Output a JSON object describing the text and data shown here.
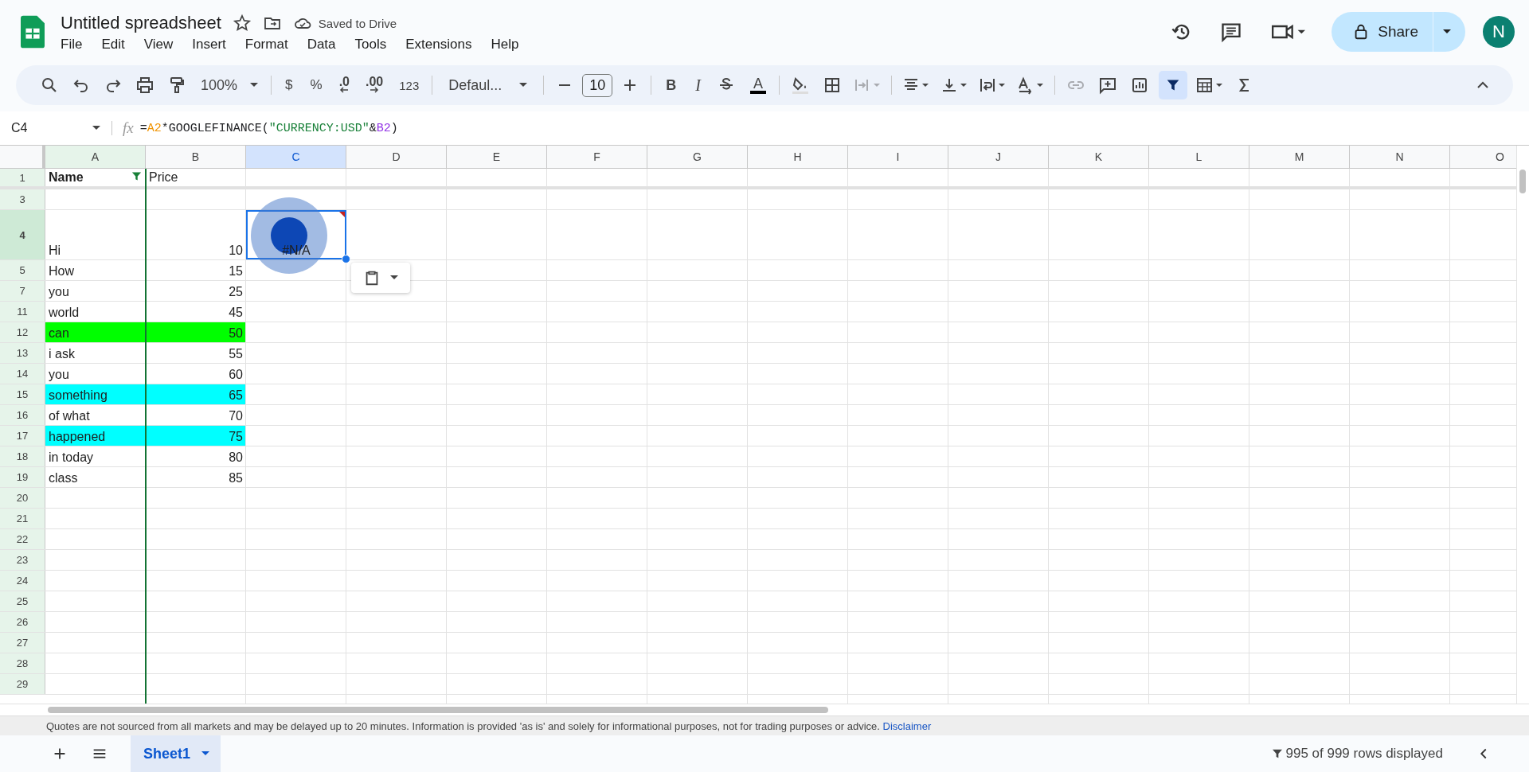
{
  "title": "Untitled spreadsheet",
  "save_status": "Saved to Drive",
  "menu": [
    "File",
    "Edit",
    "View",
    "Insert",
    "Format",
    "Data",
    "Tools",
    "Extensions",
    "Help"
  ],
  "share": {
    "label": "Share"
  },
  "avatar": "N",
  "toolbar": {
    "zoom": "100%",
    "currency": "$",
    "percent": "%",
    "decimal_decrease": ".0",
    "decimal_increase": ".00",
    "number_format": "123",
    "font": "Defaul...",
    "font_size": "10",
    "bold": "B",
    "italic": "I",
    "text_color": "A",
    "merge_disabled": true,
    "link_disabled": true,
    "filter_selected": true
  },
  "formula_bar": {
    "name_box": "C4",
    "function_label": "fx",
    "formula": [
      {
        "kind": "plain",
        "text": "="
      },
      {
        "kind": "ref_a",
        "text": "A2"
      },
      {
        "kind": "plain",
        "text": "*GOOGLEFINANCE("
      },
      {
        "kind": "string",
        "text": "\"CURRENCY:USD\""
      },
      {
        "kind": "plain",
        "text": "&"
      },
      {
        "kind": "ref_b",
        "text": "B2"
      },
      {
        "kind": "plain",
        "text": ")"
      }
    ]
  },
  "columns": [
    {
      "label": "A",
      "selected": false,
      "filtered": true
    },
    {
      "label": "B",
      "selected": false,
      "filtered": false
    },
    {
      "label": "C",
      "selected": true,
      "filtered": false
    },
    {
      "label": "D",
      "selected": false,
      "filtered": false
    },
    {
      "label": "E",
      "selected": false,
      "filtered": false
    },
    {
      "label": "F",
      "selected": false,
      "filtered": false
    },
    {
      "label": "G",
      "selected": false,
      "filtered": false
    },
    {
      "label": "H",
      "selected": false,
      "filtered": false
    },
    {
      "label": "I",
      "selected": false,
      "filtered": false
    },
    {
      "label": "J",
      "selected": false,
      "filtered": false
    },
    {
      "label": "K",
      "selected": false,
      "filtered": false
    },
    {
      "label": "L",
      "selected": false,
      "filtered": false
    },
    {
      "label": "M",
      "selected": false,
      "filtered": false
    },
    {
      "label": "N",
      "selected": false,
      "filtered": false
    },
    {
      "label": "O",
      "selected": false,
      "filtered": false
    }
  ],
  "rows": [
    {
      "number": "1",
      "selected": false,
      "cells": [
        "Name",
        "Price"
      ]
    },
    {
      "number": "3",
      "selected": false,
      "cells": []
    },
    {
      "number": "4",
      "selected": true,
      "cells": [
        "Hi",
        "10",
        "#N/A"
      ]
    },
    {
      "number": "5",
      "selected": false,
      "cells": [
        "How",
        "15"
      ]
    },
    {
      "number": "7",
      "selected": false,
      "cells": [
        "you",
        "25"
      ]
    },
    {
      "number": "11",
      "selected": false,
      "cells": [
        "world",
        "45"
      ]
    },
    {
      "number": "12",
      "selected": false,
      "color": "#00ff00",
      "cells": [
        "can",
        "50"
      ]
    },
    {
      "number": "13",
      "selected": false,
      "cells": [
        "i ask",
        "55"
      ]
    },
    {
      "number": "14",
      "selected": false,
      "cells": [
        "you",
        "60"
      ]
    },
    {
      "number": "15",
      "selected": false,
      "color": "#00ffff",
      "cells": [
        "something",
        "65"
      ]
    },
    {
      "number": "16",
      "selected": false,
      "cells": [
        "of what",
        "70"
      ]
    },
    {
      "number": "17",
      "selected": false,
      "color": "#00ffff",
      "cells": [
        "happened",
        "75"
      ]
    },
    {
      "number": "18",
      "selected": false,
      "cells": [
        "in today",
        "80"
      ]
    },
    {
      "number": "19",
      "selected": false,
      "cells": [
        "class",
        "85"
      ]
    },
    {
      "number": "20",
      "selected": false,
      "cells": []
    },
    {
      "number": "21",
      "selected": false,
      "cells": []
    },
    {
      "number": "22",
      "selected": false,
      "cells": []
    },
    {
      "number": "23",
      "selected": false,
      "cells": []
    },
    {
      "number": "24",
      "selected": false,
      "cells": []
    },
    {
      "number": "25",
      "selected": false,
      "cells": []
    },
    {
      "number": "26",
      "selected": false,
      "cells": []
    },
    {
      "number": "27",
      "selected": false,
      "cells": []
    },
    {
      "number": "28",
      "selected": false,
      "cells": []
    },
    {
      "number": "29",
      "selected": false,
      "cells": []
    }
  ],
  "notice": {
    "text": "Quotes are not sourced from all markets and may be delayed up to 20 minutes. Information is provided 'as is' and solely for informational purposes, not for trading purposes or advice.",
    "link": "Disclaimer"
  },
  "sheets": [
    {
      "label": "Sheet1",
      "selected": true
    }
  ],
  "rows_displayed": "995 of 999 rows displayed"
}
